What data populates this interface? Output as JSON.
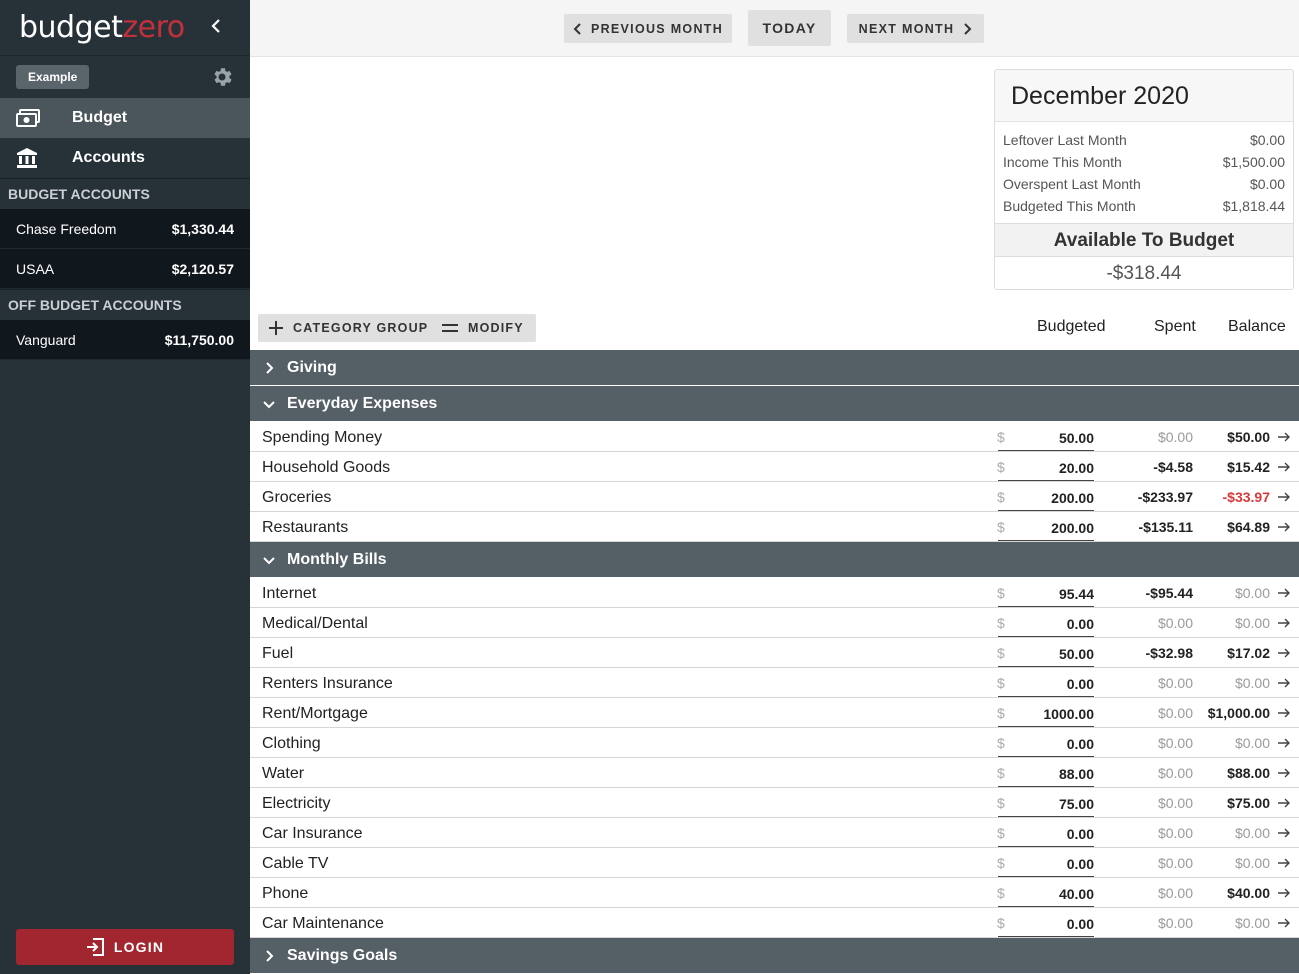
{
  "brand": {
    "part1": "budget",
    "part2": "zero"
  },
  "sidebar": {
    "budget_chip": "Example",
    "nav": [
      {
        "label": "Budget",
        "icon": "money-icon",
        "active": true
      },
      {
        "label": "Accounts",
        "icon": "bank-icon",
        "active": false
      }
    ],
    "budget_accounts_title": "BUDGET ACCOUNTS",
    "budget_accounts": [
      {
        "name": "Chase Freedom",
        "balance": "$1,330.44"
      },
      {
        "name": "USAA",
        "balance": "$2,120.57"
      }
    ],
    "off_budget_title": "OFF BUDGET ACCOUNTS",
    "off_budget_accounts": [
      {
        "name": "Vanguard",
        "balance": "$11,750.00"
      }
    ],
    "login_label": "LOGIN"
  },
  "topbar": {
    "prev_label": "PREVIOUS MONTH",
    "today_label": "TODAY",
    "next_label": "NEXT MONTH"
  },
  "summary": {
    "month": "December 2020",
    "rows": [
      {
        "label": "Leftover Last Month",
        "value": "$0.00"
      },
      {
        "label": "Income This Month",
        "value": "$1,500.00"
      },
      {
        "label": "Overspent Last Month",
        "value": "$0.00"
      },
      {
        "label": "Budgeted This Month",
        "value": "$1,818.44"
      }
    ],
    "available_label": "Available To Budget",
    "available_value": "-$318.44"
  },
  "actions": {
    "category_group_label": "CATEGORY GROUP",
    "modify_label": "MODIFY"
  },
  "columns": {
    "budgeted": "Budgeted",
    "spent": "Spent",
    "balance": "Balance"
  },
  "currency_symbol": "$",
  "groups": [
    {
      "name": "Giving",
      "expanded": false,
      "categories": []
    },
    {
      "name": "Everyday Expenses",
      "expanded": true,
      "categories": [
        {
          "name": "Spending Money",
          "budgeted": "50.00",
          "spent": "$0.00",
          "balance": "$50.00"
        },
        {
          "name": "Household Goods",
          "budgeted": "20.00",
          "spent": "-$4.58",
          "balance": "$15.42"
        },
        {
          "name": "Groceries",
          "budgeted": "200.00",
          "spent": "-$233.97",
          "balance": "-$33.97"
        },
        {
          "name": "Restaurants",
          "budgeted": "200.00",
          "spent": "-$135.11",
          "balance": "$64.89"
        }
      ]
    },
    {
      "name": "Monthly Bills",
      "expanded": true,
      "categories": [
        {
          "name": "Internet",
          "budgeted": "95.44",
          "spent": "-$95.44",
          "balance": "$0.00"
        },
        {
          "name": "Medical/Dental",
          "budgeted": "0.00",
          "spent": "$0.00",
          "balance": "$0.00"
        },
        {
          "name": "Fuel",
          "budgeted": "50.00",
          "spent": "-$32.98",
          "balance": "$17.02"
        },
        {
          "name": "Renters Insurance",
          "budgeted": "0.00",
          "spent": "$0.00",
          "balance": "$0.00"
        },
        {
          "name": "Rent/Mortgage",
          "budgeted": "1000.00",
          "spent": "$0.00",
          "balance": "$1,000.00"
        },
        {
          "name": "Clothing",
          "budgeted": "0.00",
          "spent": "$0.00",
          "balance": "$0.00"
        },
        {
          "name": "Water",
          "budgeted": "88.00",
          "spent": "$0.00",
          "balance": "$88.00"
        },
        {
          "name": "Electricity",
          "budgeted": "75.00",
          "spent": "$0.00",
          "balance": "$75.00"
        },
        {
          "name": "Car Insurance",
          "budgeted": "0.00",
          "spent": "$0.00",
          "balance": "$0.00"
        },
        {
          "name": "Cable TV",
          "budgeted": "0.00",
          "spent": "$0.00",
          "balance": "$0.00"
        },
        {
          "name": "Phone",
          "budgeted": "40.00",
          "spent": "$0.00",
          "balance": "$40.00"
        },
        {
          "name": "Car Maintenance",
          "budgeted": "0.00",
          "spent": "$0.00",
          "balance": "$0.00"
        }
      ]
    },
    {
      "name": "Savings Goals",
      "expanded": false,
      "categories": []
    }
  ],
  "colors": {
    "brand_red": "#c2313b",
    "negative": "#d9383b",
    "group_bg": "#545f66",
    "sidebar_bg": "#273238"
  }
}
